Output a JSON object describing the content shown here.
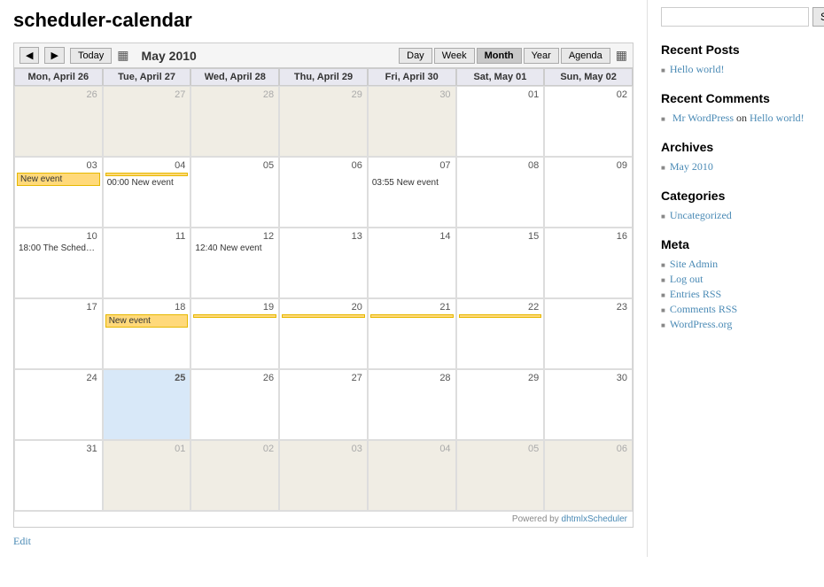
{
  "page": {
    "title": "scheduler-calendar"
  },
  "calendar": {
    "month_label": "May 2010",
    "view_buttons": [
      "Day",
      "Week",
      "Month",
      "Year",
      "Agenda"
    ],
    "active_view": "Month",
    "headers": [
      "Mon, April 26",
      "Tue, April 27",
      "Wed, April 28",
      "Thu, April 29",
      "Fri, April 30",
      "Sat, May 01",
      "Sun, May 02"
    ],
    "powered_by_text": "Powered by ",
    "powered_by_link": "dhtmlxScheduler"
  },
  "sidebar": {
    "search_placeholder": "",
    "search_button": "Search",
    "recent_posts": {
      "title": "Recent Posts",
      "items": [
        "Hello world!"
      ]
    },
    "recent_comments": {
      "title": "Recent Comments",
      "author": "Mr WordPress",
      "on": "on",
      "post": "Hello world!"
    },
    "archives": {
      "title": "Archives",
      "items": [
        "May 2010"
      ]
    },
    "categories": {
      "title": "Categories",
      "items": [
        "Uncategorized"
      ]
    },
    "meta": {
      "title": "Meta",
      "items": [
        "Site Admin",
        "Log out",
        "Entries RSS",
        "Comments RSS",
        "WordPress.org"
      ]
    }
  },
  "edit_link": "Edit"
}
